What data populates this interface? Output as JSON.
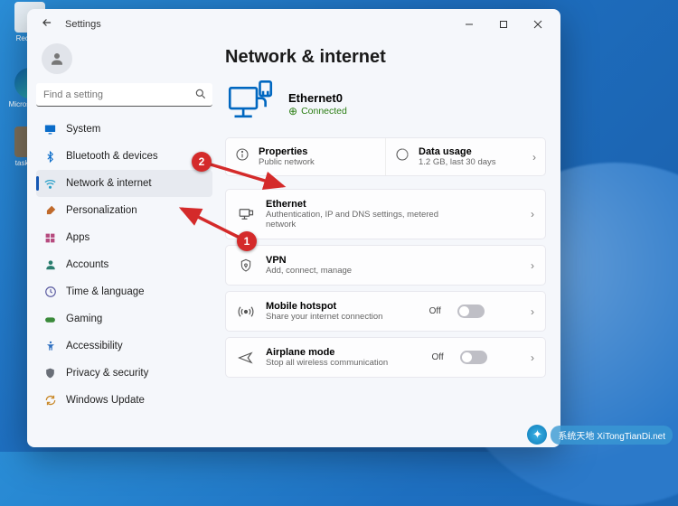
{
  "desktop": {
    "icons": {
      "recycle": "Recycl...",
      "edge": "Micros...\nEdg",
      "taskbar": "taskbar..."
    },
    "watermark": "系统天地 XiTongTianDi.net"
  },
  "window": {
    "title": "Settings",
    "search_placeholder": "Find a setting"
  },
  "sidebar": {
    "items": [
      {
        "label": "System",
        "icon": "display",
        "color": "#0a6cc9"
      },
      {
        "label": "Bluetooth & devices",
        "icon": "bluetooth",
        "color": "#0a6cc9"
      },
      {
        "label": "Network & internet",
        "icon": "wifi",
        "color": "#0a8bbf",
        "active": true
      },
      {
        "label": "Personalization",
        "icon": "brush",
        "color": "#c06a2b"
      },
      {
        "label": "Apps",
        "icon": "grid",
        "color": "#b64a7e"
      },
      {
        "label": "Accounts",
        "icon": "person",
        "color": "#2a7d6e"
      },
      {
        "label": "Time & language",
        "icon": "clock",
        "color": "#5a5aa0"
      },
      {
        "label": "Gaming",
        "icon": "game",
        "color": "#3a8a3a"
      },
      {
        "label": "Accessibility",
        "icon": "access",
        "color": "#2a6dbf"
      },
      {
        "label": "Privacy & security",
        "icon": "shield",
        "color": "#6a6f78"
      },
      {
        "label": "Windows Update",
        "icon": "update",
        "color": "#c9892a"
      }
    ]
  },
  "page": {
    "title": "Network & internet",
    "connection": {
      "name": "Ethernet0",
      "status": "Connected"
    },
    "row": {
      "properties": {
        "title": "Properties",
        "subtitle": "Public network"
      },
      "usage": {
        "title": "Data usage",
        "subtitle": "1.2 GB, last 30 days"
      }
    },
    "cards": [
      {
        "id": "ethernet",
        "title": "Ethernet",
        "subtitle": "Authentication, IP and DNS settings, metered network"
      },
      {
        "id": "vpn",
        "title": "VPN",
        "subtitle": "Add, connect, manage"
      },
      {
        "id": "hotspot",
        "title": "Mobile hotspot",
        "subtitle": "Share your internet connection",
        "toggle": "Off"
      },
      {
        "id": "airplane",
        "title": "Airplane mode",
        "subtitle": "Stop all wireless communication",
        "toggle": "Off"
      }
    ]
  },
  "annotations": {
    "badge1": "1",
    "badge2": "2"
  }
}
